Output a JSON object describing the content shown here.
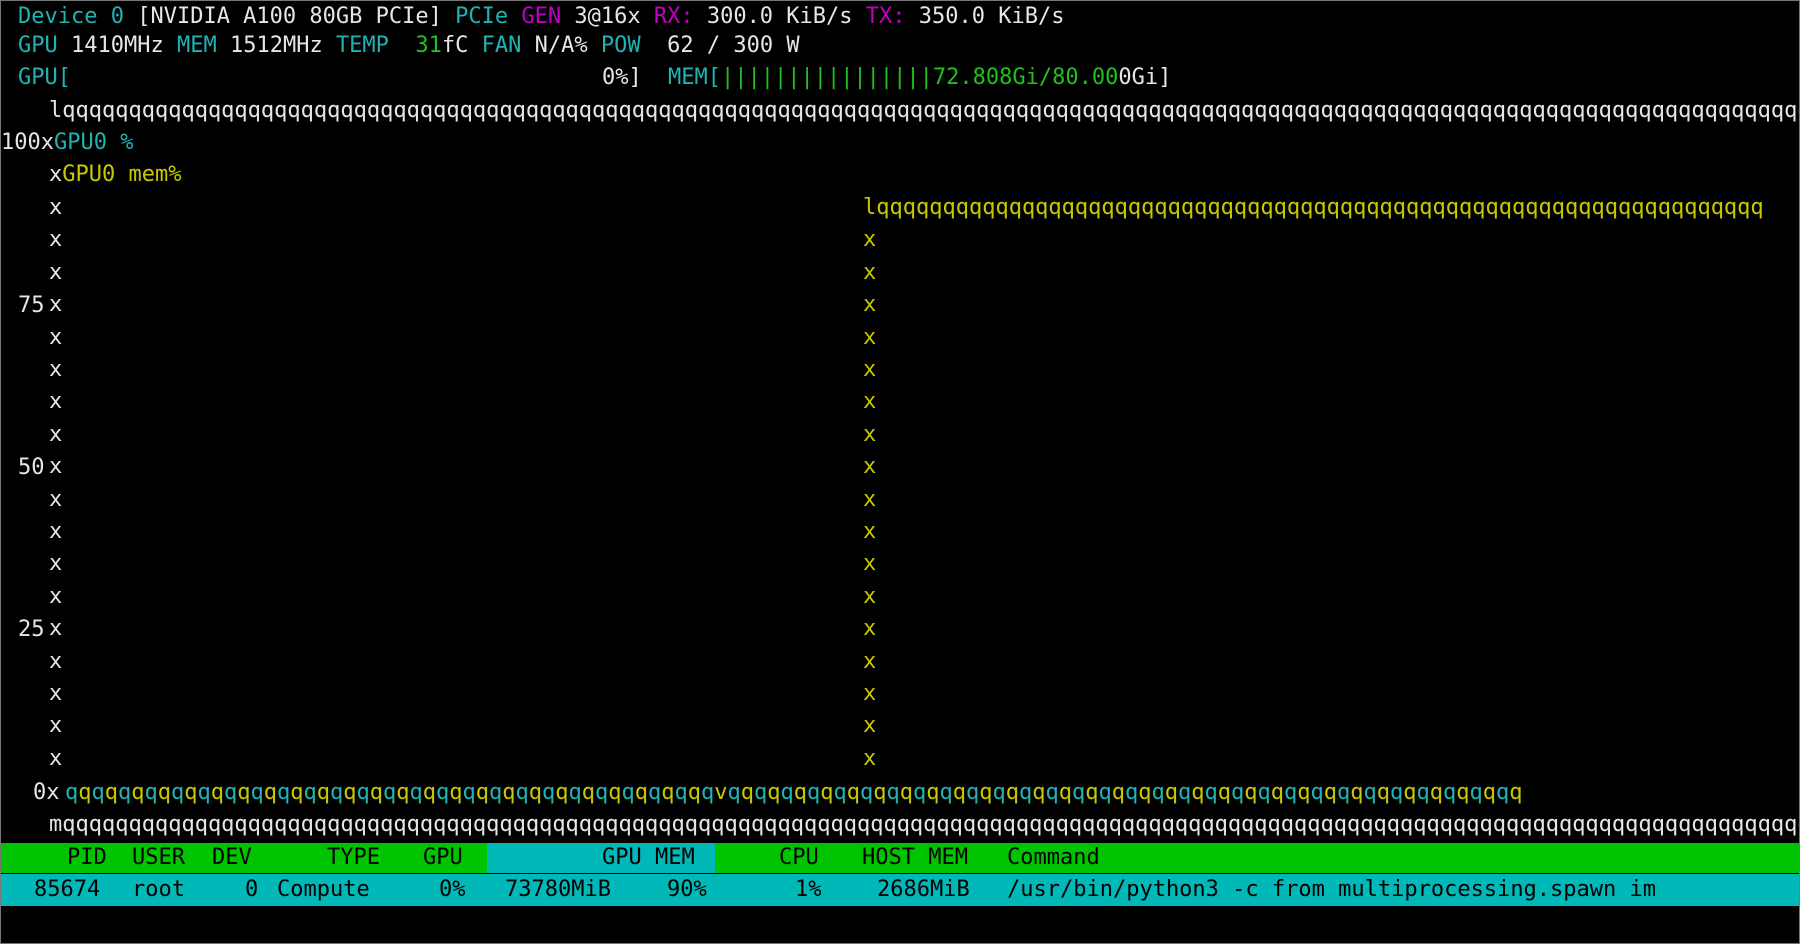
{
  "header": {
    "device_label": "Device 0",
    "device_name": "[NVIDIA A100 80GB PCIe]",
    "pcie_label": "PCIe",
    "gen_label": "GEN",
    "gen_value": "3@16x",
    "rx_label": "RX:",
    "rx_value": "300.0 KiB/s",
    "tx_label": "TX:",
    "tx_value": "350.0 KiB/s",
    "gpu_clock_label": "GPU",
    "gpu_clock_value": "1410MHz",
    "mem_clock_label": "MEM",
    "mem_clock_value": "1512MHz",
    "temp_label": "TEMP",
    "temp_value": "31",
    "temp_unit": "fC",
    "fan_label": "FAN",
    "fan_value": "N/A%",
    "pow_label": "POW",
    "pow_value": "62 / 300 W",
    "gpu_util_label": "GPU[",
    "gpu_util_value": "0%]",
    "gpu_util_percent": 0,
    "mem_usage_label": "MEM[",
    "mem_usage_bars": "||||||||||||||||",
    "mem_usage_green": "72.808Gi/80.00",
    "mem_usage_white": "0Gi]",
    "mem_usage_fraction": 0.91
  },
  "chart": {
    "top_border": "lqqqqqqqqqqqqqqqqqqqqqqqqqqqqqqqqqqqqqqqqqqqqqqqqqqqqqqqqqqqqqqqqqqqqqqqqqqqqqqqqqqqqqqqqqqqqqqqqqqqqqqqqqqqqqqqqqqqqqqqqqqqqqqqqqqqqqqqq",
    "bottom_border": "mqqqqqqqqqqqqqqqqqqqqqqqqqqqqqqqqqqqqqqqqqqqqqqqqqqqqqqqqqqqqqqqqqqqqqqqqqqqqqqqqqqqqqqqqqqqqqqqqqqqqqqqqqqqqqqqqqqqqqqqqqqqqqqqqqqqqqqqq",
    "legend_gpu": "GPU0 %",
    "legend_mem": "GPU0 mem%",
    "y_tick_100": "100",
    "y_tick_75": "75",
    "y_tick_50": "50",
    "y_tick_25": "25",
    "y_tick_0": "0",
    "axis_char": "x",
    "line_char": "q",
    "mem_top_line": "lqqqqqqqqqqqqqqqqqqqqqqqqqqqqqqqqqqqqqqqqqqqqqqqqqqqqqqqqqqqqqqqqqqq",
    "rise_char": "v"
  },
  "chart_data": {
    "type": "line",
    "ylim": [
      0,
      100
    ],
    "y_ticks": [
      "100",
      "75",
      "50",
      "25",
      "0"
    ],
    "series": [
      {
        "name": "GPU0 %",
        "values": [
          0,
          0,
          0,
          0,
          0,
          0,
          0,
          0,
          0,
          0,
          0,
          0,
          0,
          0,
          0,
          0,
          0,
          0,
          0,
          0
        ]
      },
      {
        "name": "GPU0 mem%",
        "values": [
          0,
          0,
          0,
          0,
          0,
          0,
          0,
          0,
          0,
          0,
          0,
          0,
          0,
          90,
          90,
          90,
          90,
          90,
          90,
          90
        ]
      }
    ]
  },
  "process_table": {
    "headers": {
      "pid": "PID",
      "user": "USER",
      "dev": "DEV",
      "type": "TYPE",
      "gpu": "GPU",
      "gpu_mem": "GPU MEM",
      "cpu": "CPU",
      "host_mem": "HOST MEM",
      "command": "Command"
    },
    "rows": [
      {
        "pid": "85674",
        "user": "root",
        "dev": "0",
        "type": "Compute",
        "gpu": "0%",
        "gpu_mem": "73780MiB",
        "gpu_mem_pct": "90%",
        "cpu": "1%",
        "host_mem": "2686MiB",
        "command": "/usr/bin/python3 -c from multiprocessing.spawn im"
      }
    ]
  },
  "colors": {
    "background": "#000000",
    "cyan": "#1fb3b3",
    "magenta": "#c000c0",
    "green": "#1fc01f",
    "yellow": "#c8c800",
    "header_bar_green": "#00c400",
    "row_bar_cyan": "#00b8b8"
  }
}
